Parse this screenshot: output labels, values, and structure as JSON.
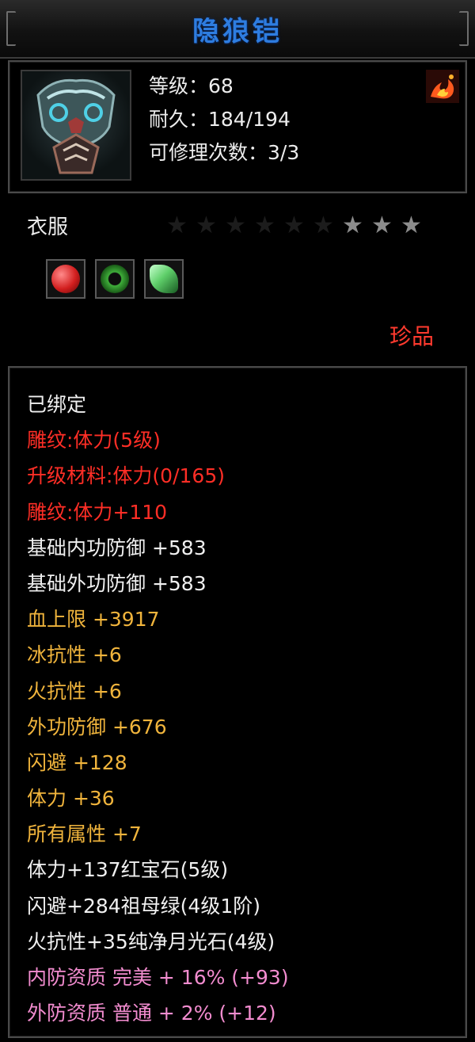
{
  "window": {
    "title": "隐狼铠"
  },
  "item": {
    "icon": "armor-icon",
    "level_text": "等级：68",
    "durability_text": "耐久：184/194",
    "repair_text": "可修理次数：3/3",
    "flag_icon": "fire-dragon-icon"
  },
  "category": "衣服",
  "stars": {
    "total": 9,
    "lit": 3
  },
  "gems": [
    {
      "icon": "ruby-gem-icon",
      "color": "#d21e1e"
    },
    {
      "icon": "jade-ring-icon",
      "color": "#3fae3a"
    },
    {
      "icon": "emerald-gem-icon",
      "color": "#5fcf6a"
    }
  ],
  "rarity": "珍品",
  "colors": {
    "title": "#2e7de0",
    "white": "#f0f0f0",
    "red": "#ff2e26",
    "orange": "#f0b43c",
    "pink": "#f28ccf"
  },
  "stats": [
    {
      "text": "已绑定",
      "color": "white"
    },
    {
      "text": "雕纹:体力(5级)",
      "color": "red"
    },
    {
      "text": "升级材料:体力(0/165)",
      "color": "red"
    },
    {
      "text": "雕纹:体力+110",
      "color": "red"
    },
    {
      "text": "基础内功防御 +583",
      "color": "white"
    },
    {
      "text": "基础外功防御 +583",
      "color": "white"
    },
    {
      "text": "血上限 +3917",
      "color": "orange"
    },
    {
      "text": "冰抗性 +6",
      "color": "orange"
    },
    {
      "text": "火抗性 +6",
      "color": "orange"
    },
    {
      "text": "外功防御 +676",
      "color": "orange"
    },
    {
      "text": "闪避 +128",
      "color": "orange"
    },
    {
      "text": "体力 +36",
      "color": "orange"
    },
    {
      "text": "所有属性 +7",
      "color": "orange"
    },
    {
      "text": "体力+137红宝石(5级)",
      "color": "white"
    },
    {
      "text": "闪避+284祖母绿(4级1阶)",
      "color": "white"
    },
    {
      "text": "火抗性+35纯净月光石(4级)",
      "color": "white"
    },
    {
      "text": "内防资质 完美 + 16% (+93)",
      "color": "pink"
    },
    {
      "text": "外防资质 普通 + 2% (+12)",
      "color": "pink"
    }
  ]
}
